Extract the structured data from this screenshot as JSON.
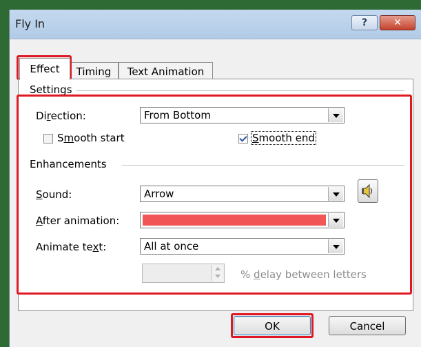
{
  "window": {
    "title": "Fly In",
    "help_glyph": "?",
    "close_glyph": "✕"
  },
  "tabs": [
    {
      "label": "Effect",
      "active": true
    },
    {
      "label": "Timing",
      "active": false
    },
    {
      "label": "Text Animation",
      "active": false
    }
  ],
  "settings": {
    "group_label": "Settings",
    "direction": {
      "label": "Direction:",
      "value": "From Bottom"
    },
    "smooth_start": {
      "label": "Smooth start",
      "checked": false
    },
    "smooth_end": {
      "label": "Smooth end",
      "checked": true
    }
  },
  "enhancements": {
    "group_label": "Enhancements",
    "sound": {
      "label": "Sound:",
      "value": "Arrow",
      "button_icon": "speaker-icon"
    },
    "after_animation": {
      "label": "After animation:",
      "value": "",
      "color": "#f25555"
    },
    "animate_text": {
      "label": "Animate text:",
      "value": "All at once"
    },
    "delay": {
      "value": "",
      "label": "% delay between letters"
    }
  },
  "buttons": {
    "ok": "OK",
    "cancel": "Cancel"
  },
  "colors": {
    "highlight": "#e01822",
    "titlebar": "#c4d9ef"
  }
}
